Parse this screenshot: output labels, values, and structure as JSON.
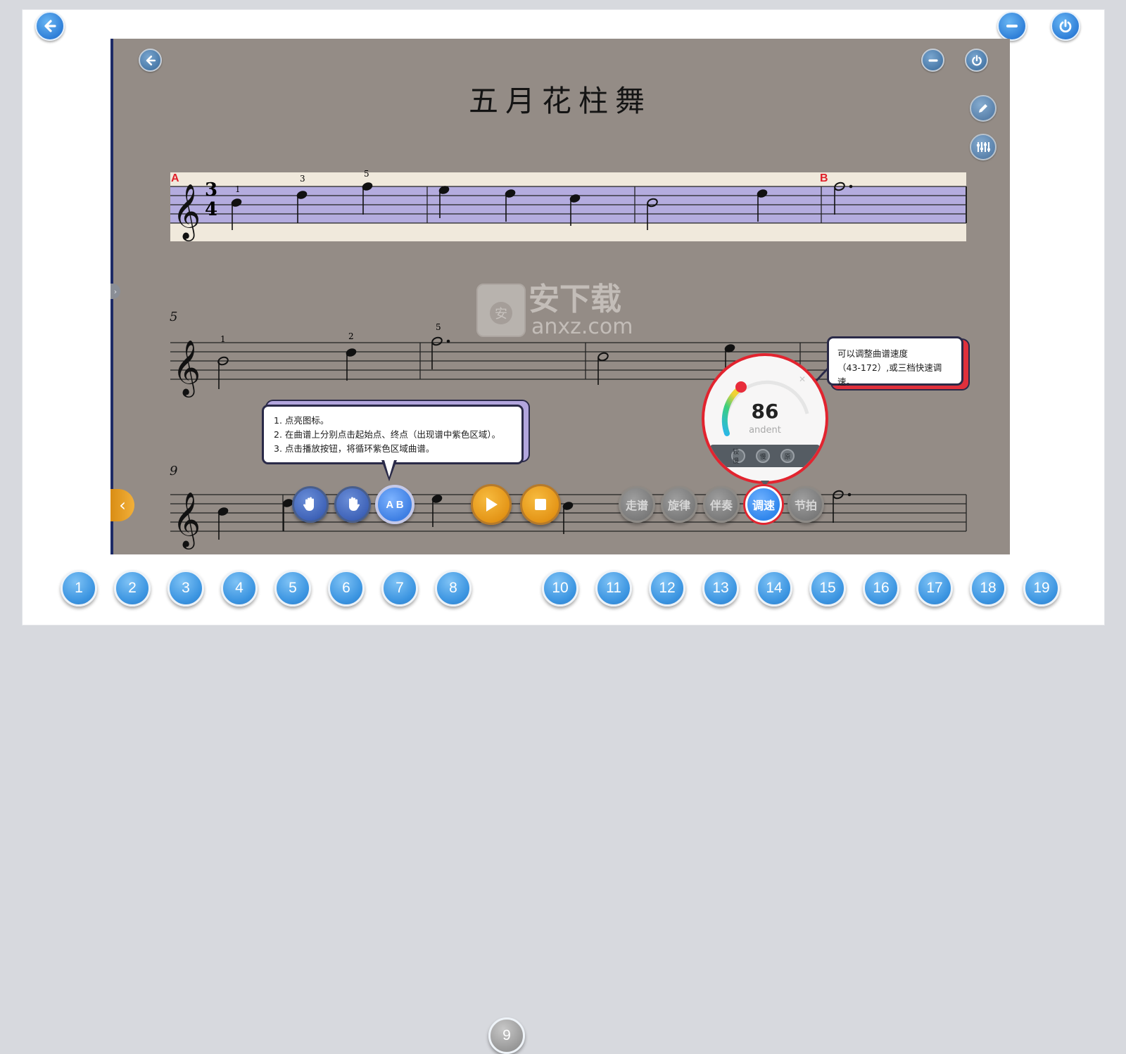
{
  "app": {
    "title": "五月花柱舞",
    "accent_color": "#3c95e1",
    "highlight_color": "#e2242f"
  },
  "window_controls": {
    "back_icon": "arrow-left-icon",
    "minimize_icon": "minus-icon",
    "power_icon": "power-icon"
  },
  "score": {
    "loop_start_mark": "A",
    "loop_end_mark": "B",
    "time_signature_top": "3",
    "time_signature_bottom": "4",
    "measure_numbers": [
      "5",
      "9"
    ],
    "fingerings": [
      "1",
      "3",
      "5",
      "1",
      "2",
      "5"
    ]
  },
  "side_tools": [
    "pencil-icon",
    "mixer-icon"
  ],
  "tips": {
    "loop_tip_lines": [
      "1. 点亮图标。",
      "2. 在曲谱上分别点击起始点、终点（出现谱中紫色区域）。",
      "3. 点击播放按钮，将循环紫色区域曲谱。"
    ],
    "tempo_tip_lines": [
      "可以调整曲谱速度",
      "（43-172）,或三档快速调速。"
    ]
  },
  "tempo": {
    "value": "86",
    "name": "andent",
    "presets": [
      "较慢",
      "慢",
      "原"
    ]
  },
  "controls": {
    "left_hand_icon": "left-hand-icon",
    "right_hand_icon": "right-hand-icon",
    "ab_loop_label": "A B",
    "play_icon": "play-icon",
    "stop_icon": "stop-icon",
    "modes": [
      "走谱",
      "旋律",
      "伴奏",
      "调速",
      "节拍"
    ],
    "active_mode": "调速"
  },
  "watermark": {
    "text": "安下载",
    "subtext": "anxz.com"
  },
  "pages": [
    "1",
    "2",
    "3",
    "4",
    "5",
    "6",
    "7",
    "8",
    "9",
    "10",
    "11",
    "12",
    "13",
    "14",
    "15",
    "16",
    "17",
    "18",
    "19"
  ],
  "current_page": "9"
}
